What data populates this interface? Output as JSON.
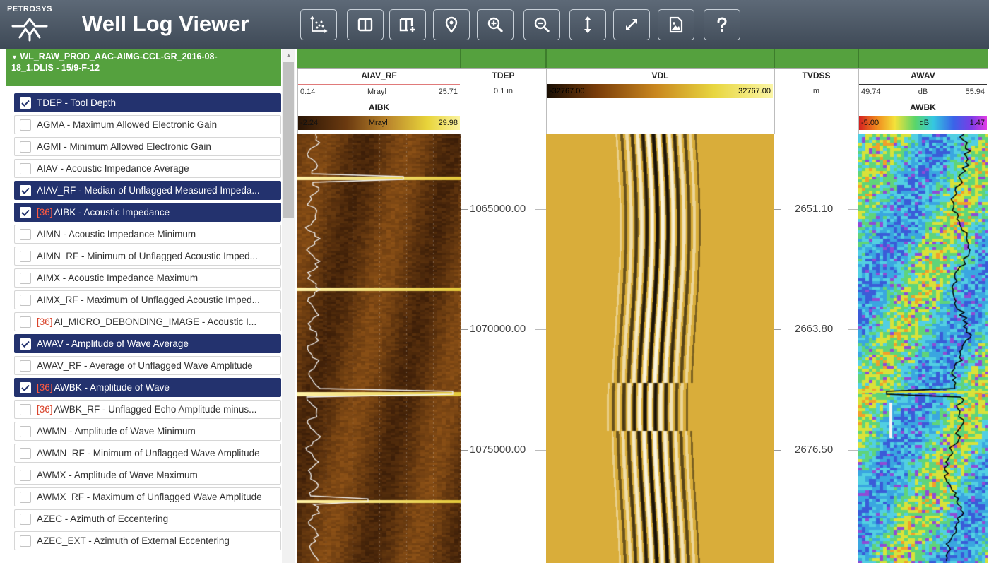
{
  "app": {
    "brand": "PETROSYS",
    "title": "Well Log Viewer"
  },
  "toolbar": [
    {
      "name": "crossplot-tool-button",
      "icon": "crossplot-icon"
    },
    {
      "name": "split-view-button",
      "icon": "columns-icon"
    },
    {
      "name": "add-track-button",
      "icon": "add-track-icon"
    },
    {
      "name": "marker-button",
      "icon": "map-pin-icon"
    },
    {
      "name": "zoom-in-button",
      "icon": "zoom-in-icon"
    },
    {
      "name": "zoom-out-button",
      "icon": "zoom-out-icon"
    },
    {
      "name": "depth-range-button",
      "icon": "vertical-arrows-icon"
    },
    {
      "name": "fit-button",
      "icon": "expand-icon"
    },
    {
      "name": "export-image-button",
      "icon": "image-file-icon"
    },
    {
      "name": "help-button",
      "icon": "question-icon"
    }
  ],
  "sidebar": {
    "file_line1": "WL_RAW_PROD_AAC-AIMG-CCL-GR_2016-08-",
    "file_line2": "18_1.DLIS - 15/9-F-12",
    "items": [
      {
        "tag": "",
        "label": "TDEP - Tool Depth",
        "checked": true
      },
      {
        "tag": "",
        "label": "AGMA - Maximum Allowed Electronic Gain",
        "checked": false
      },
      {
        "tag": "",
        "label": "AGMI - Minimum Allowed Electronic Gain",
        "checked": false
      },
      {
        "tag": "",
        "label": "AIAV - Acoustic Impedance Average",
        "checked": false
      },
      {
        "tag": "",
        "label": "AIAV_RF - Median of Unflagged Measured Impeda...",
        "checked": true
      },
      {
        "tag": "[36]",
        "label": "AIBK - Acoustic Impedance",
        "checked": true
      },
      {
        "tag": "",
        "label": "AIMN - Acoustic Impedance Minimum",
        "checked": false
      },
      {
        "tag": "",
        "label": "AIMN_RF - Minimum of Unflagged Acoustic Imped...",
        "checked": false
      },
      {
        "tag": "",
        "label": "AIMX - Acoustic Impedance Maximum",
        "checked": false
      },
      {
        "tag": "",
        "label": "AIMX_RF - Maximum of Unflagged Acoustic Imped...",
        "checked": false
      },
      {
        "tag": "[36]",
        "label": "AI_MICRO_DEBONDING_IMAGE - Acoustic I...",
        "checked": false
      },
      {
        "tag": "",
        "label": "AWAV - Amplitude of Wave Average",
        "checked": true
      },
      {
        "tag": "",
        "label": "AWAV_RF - Average of Unflagged Wave Amplitude",
        "checked": false
      },
      {
        "tag": "[36]",
        "label": "AWBK - Amplitude of Wave",
        "checked": true
      },
      {
        "tag": "[36]",
        "label": "AWBK_RF - Unflagged Echo Amplitude minus...",
        "checked": false
      },
      {
        "tag": "",
        "label": "AWMN - Amplitude of Wave Minimum",
        "checked": false
      },
      {
        "tag": "",
        "label": "AWMN_RF - Minimum of Unflagged Wave Amplitude",
        "checked": false
      },
      {
        "tag": "",
        "label": "AWMX - Amplitude of Wave Maximum",
        "checked": false
      },
      {
        "tag": "",
        "label": "AWMX_RF - Maximum of Unflagged Wave Amplitude",
        "checked": false
      },
      {
        "tag": "",
        "label": "AZEC - Azimuth of Eccentering",
        "checked": false
      },
      {
        "tag": "",
        "label": "AZEC_EXT - Azimuth of External Eccentering",
        "checked": false
      }
    ]
  },
  "tracks": {
    "aiav_rf": {
      "name": "AIAV_RF",
      "min": "0.14",
      "unit": "Mrayl",
      "max": "25.71"
    },
    "aibk": {
      "name": "AIBK",
      "min": "-2.24",
      "unit": "Mrayl",
      "max": "29.98"
    },
    "tdep": {
      "name": "TDEP",
      "unit": "0.1 in",
      "ticks": [
        "1065000.00",
        "1070000.00",
        "1075000.00"
      ]
    },
    "vdl": {
      "name": "VDL",
      "min": "-32767.00",
      "max": "32767.00"
    },
    "tvdss": {
      "name": "TVDSS",
      "unit": "m",
      "ticks": [
        "2651.10",
        "2663.80",
        "2676.50"
      ]
    },
    "awav": {
      "name": "AWAV",
      "min": "49.74",
      "unit": "dB",
      "max": "55.94"
    },
    "awbk": {
      "name": "AWBK",
      "min": "-5.00",
      "unit": "dB",
      "max": "1.47"
    }
  },
  "colors": {
    "header_bg": "#4a5563",
    "green": "#55a13e",
    "selected": "#23326e",
    "tag": "#d9442b"
  }
}
